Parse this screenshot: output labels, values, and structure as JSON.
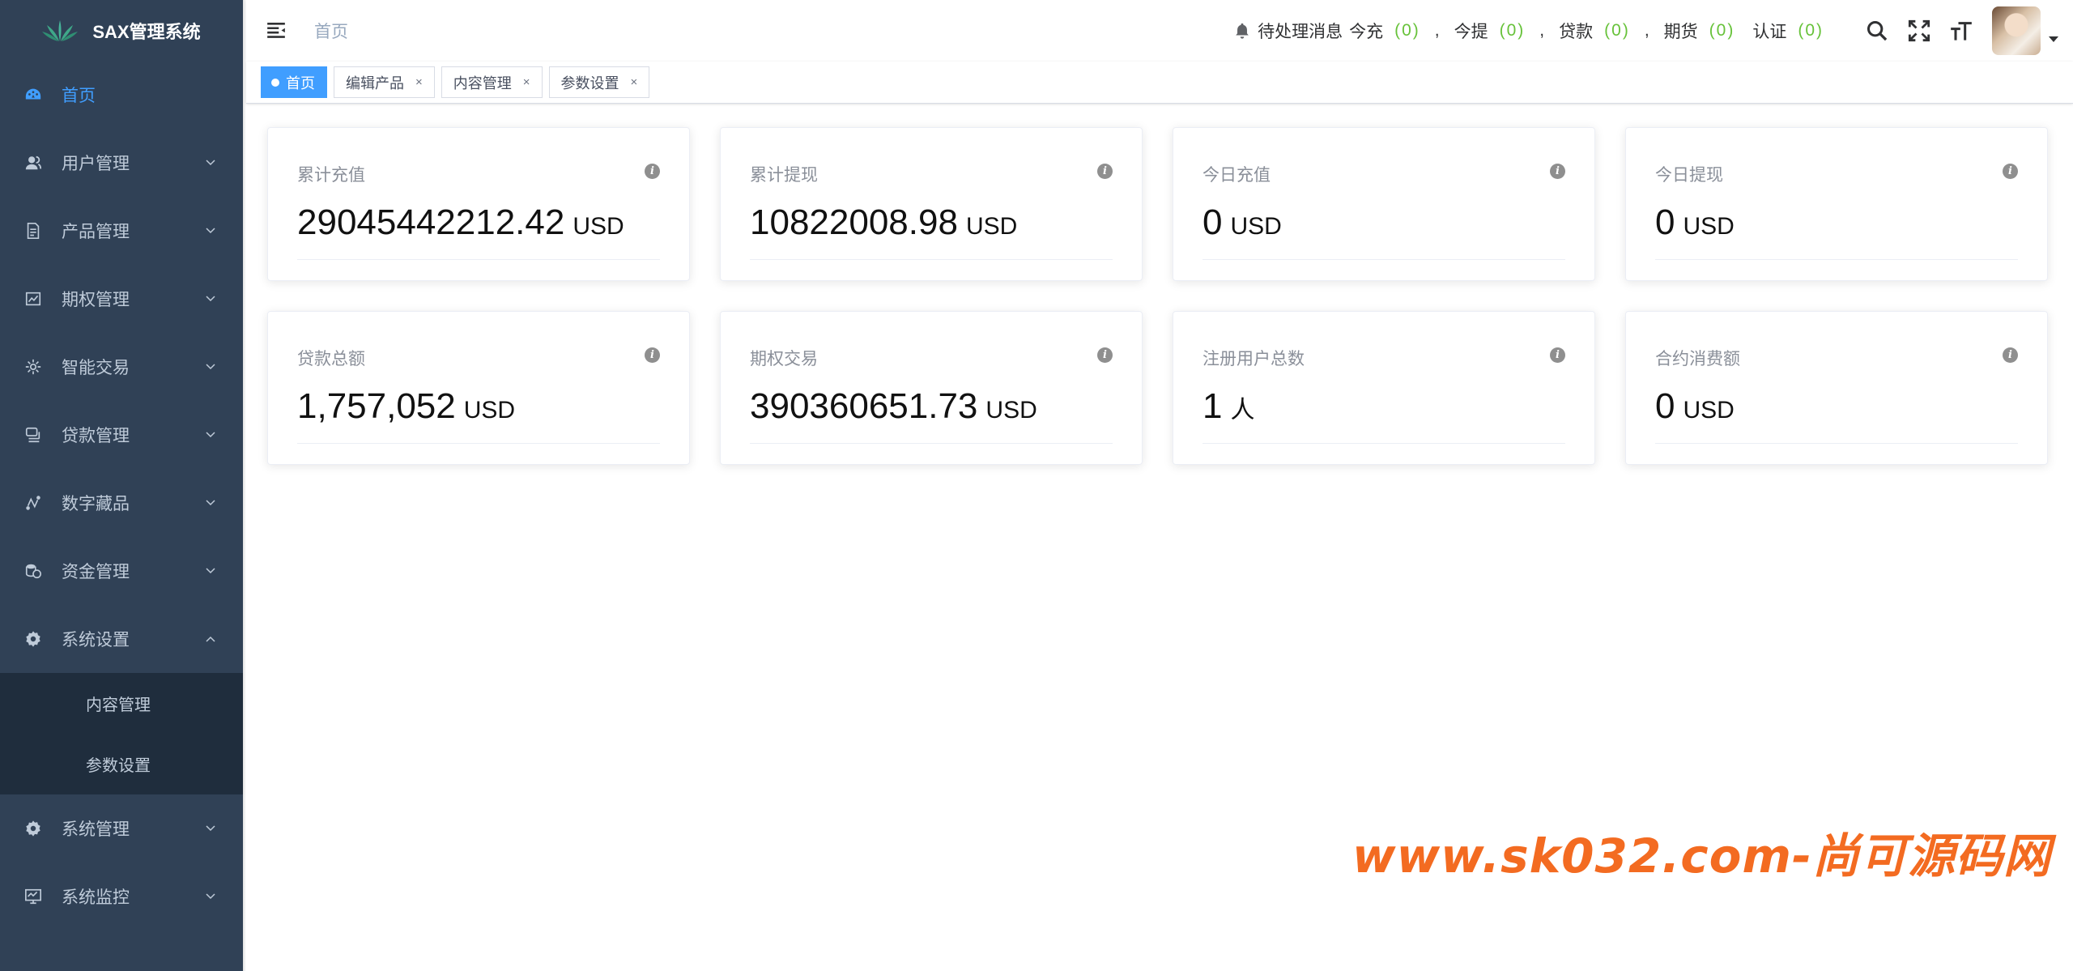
{
  "app": {
    "title": "SAX管理系统"
  },
  "sidebar": {
    "items": [
      {
        "label": "首页",
        "icon": "dashboard-icon",
        "active": true
      },
      {
        "label": "用户管理",
        "icon": "user-icon"
      },
      {
        "label": "产品管理",
        "icon": "document-icon"
      },
      {
        "label": "期权管理",
        "icon": "chart-icon"
      },
      {
        "label": "智能交易",
        "icon": "gear-small-icon"
      },
      {
        "label": "贷款管理",
        "icon": "money-icon"
      },
      {
        "label": "数字藏品",
        "icon": "route-icon"
      },
      {
        "label": "资金管理",
        "icon": "coins-icon"
      },
      {
        "label": "系统设置",
        "icon": "settings-icon",
        "expanded": true
      }
    ],
    "submenu": [
      {
        "label": "内容管理"
      },
      {
        "label": "参数设置"
      }
    ],
    "bottom_items": [
      {
        "label": "系统管理",
        "icon": "settings-icon"
      },
      {
        "label": "系统监控",
        "icon": "monitor-icon"
      }
    ]
  },
  "header": {
    "breadcrumb": "首页",
    "notice": {
      "title": "待处理消息",
      "items": [
        {
          "label": "今充",
          "count": "(0)"
        },
        {
          "label": "今提",
          "count": "(0)"
        },
        {
          "label": "贷款",
          "count": "(0)"
        },
        {
          "label": "期货",
          "count": "(0)"
        },
        {
          "label": "认证",
          "count": "(0)"
        }
      ],
      "separator": ","
    }
  },
  "tags": [
    {
      "label": "首页",
      "active": true
    },
    {
      "label": "编辑产品",
      "close": "×"
    },
    {
      "label": "内容管理",
      "close": "×"
    },
    {
      "label": "参数设置",
      "close": "×"
    }
  ],
  "cards": [
    {
      "label": "累计充值",
      "value": "29045442212.42",
      "unit": "USD"
    },
    {
      "label": "累计提现",
      "value": "10822008.98",
      "unit": "USD"
    },
    {
      "label": "今日充值",
      "value": "0",
      "unit": "USD"
    },
    {
      "label": "今日提现",
      "value": "0",
      "unit": "USD"
    },
    {
      "label": "贷款总额",
      "value": "1,757,052",
      "unit": "USD"
    },
    {
      "label": "期权交易",
      "value": "390360651.73",
      "unit": "USD"
    },
    {
      "label": "注册用户总数",
      "value": "1",
      "unit": "人"
    },
    {
      "label": "合约消费额",
      "value": "0",
      "unit": "USD"
    }
  ],
  "info_glyph": "i",
  "watermark": "www.sk032.com-尚可源码网",
  "colors": {
    "sidebar": "#304156",
    "submenu": "#1f2d3d",
    "accent": "#409eff",
    "count": "#67c23a",
    "watermark": "#f36b21"
  }
}
